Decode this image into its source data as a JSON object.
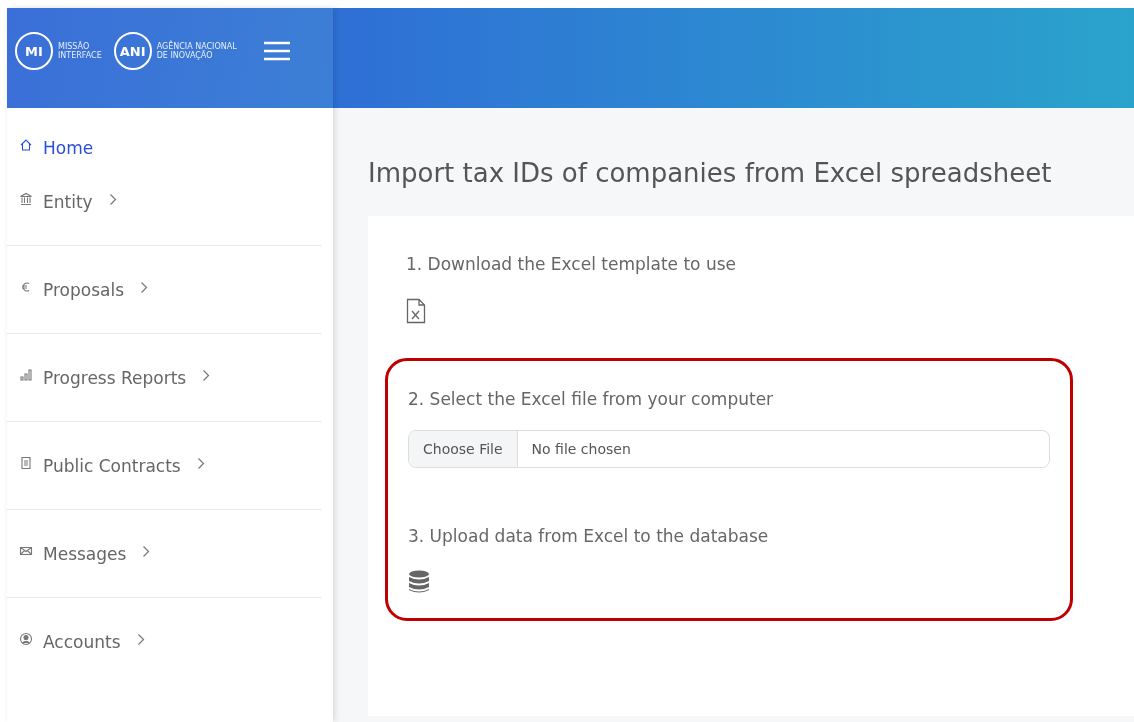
{
  "header": {
    "logos": [
      {
        "mark": "MI",
        "caption": [
          "MISSÃO",
          "INTERFACE"
        ]
      },
      {
        "mark": "ANI",
        "caption": [
          "AGÊNCIA NACIONAL",
          "DE INOVAÇÃO"
        ]
      }
    ]
  },
  "sidebar": {
    "items": [
      {
        "label": "Home",
        "selected": true,
        "expandable": false
      },
      {
        "label": "Entity",
        "selected": false,
        "expandable": true
      },
      {
        "label": "Proposals",
        "selected": false,
        "expandable": true
      },
      {
        "label": "Progress Reports",
        "selected": false,
        "expandable": true
      },
      {
        "label": "Public Contracts",
        "selected": false,
        "expandable": true
      },
      {
        "label": "Messages",
        "selected": false,
        "expandable": true
      },
      {
        "label": "Accounts",
        "selected": false,
        "expandable": true
      }
    ]
  },
  "page": {
    "title": "Import tax IDs of companies from Excel spreadsheet",
    "step_1": {
      "label": "1. Download the Excel template to use"
    },
    "highlighted": true,
    "step_2": {
      "label": "2. Select the Excel file from your computer",
      "button": "Choose File",
      "placeholder": "No file chosen"
    },
    "step_3": {
      "label": "3. Upload data from Excel to the database"
    }
  }
}
